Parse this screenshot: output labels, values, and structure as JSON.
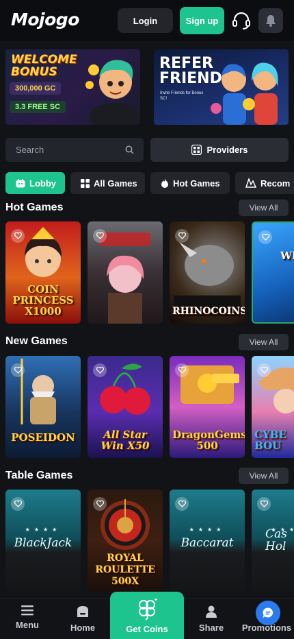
{
  "header": {
    "logo_text": "Mojogo",
    "login_label": "Login",
    "signup_label": "Sign up"
  },
  "banners": {
    "welcome": {
      "title_line1": "WELCOME",
      "title_line2": "BONUS",
      "gc": "300,000 GC",
      "sc": "3.3 FREE SC"
    },
    "refer": {
      "title_line1": "REFER",
      "title_line2": "FRIENDS",
      "subtitle": "Invite Friends for Bonus SC!"
    }
  },
  "search": {
    "placeholder": "Search"
  },
  "providers_label": "Providers",
  "tabs": [
    {
      "label": "Lobby",
      "icon": "lobby-icon",
      "active": true
    },
    {
      "label": "All Games",
      "icon": "grid-icon",
      "active": false
    },
    {
      "label": "Hot Games",
      "icon": "flame-icon",
      "active": false
    },
    {
      "label": "Recom",
      "icon": "recommend-icon",
      "active": false
    }
  ],
  "sections": [
    {
      "title": "Hot Games",
      "view_all": "View All",
      "games": [
        {
          "name": "COIN\nPRINCESS\nX1000",
          "theme": "g-coin"
        },
        {
          "name": "",
          "theme": "g-hall"
        },
        {
          "name": "RHINOCOINS",
          "theme": "g-rhino"
        },
        {
          "name": "WIN",
          "theme": "g-wind"
        }
      ]
    },
    {
      "title": "New Games",
      "view_all": "View All",
      "games": [
        {
          "name": "POSEIDON",
          "theme": "g-pos"
        },
        {
          "name": "All Star\nWin X50",
          "theme": "g-star"
        },
        {
          "name": "DragonGems\n500",
          "theme": "g-dragon"
        },
        {
          "name": "CYBE\nBOU",
          "theme": "g-cyber"
        }
      ]
    },
    {
      "title": "Table Games",
      "view_all": "View All",
      "games": [
        {
          "name": "BlackJack",
          "theme": "g-table"
        },
        {
          "name": "ROYAL\nROULETTE\n500X",
          "theme": "g-roul"
        },
        {
          "name": "Baccarat",
          "theme": "g-table"
        },
        {
          "name": "Cas\nHol",
          "theme": "g-table"
        }
      ]
    }
  ],
  "bottom_nav": {
    "menu": "Menu",
    "home": "Home",
    "get_coins": "Get Coins",
    "share": "Share",
    "promotions": "Promotions"
  },
  "colors": {
    "accent": "#1dc48d",
    "background": "#121316",
    "chat": "#2b7bf0"
  }
}
